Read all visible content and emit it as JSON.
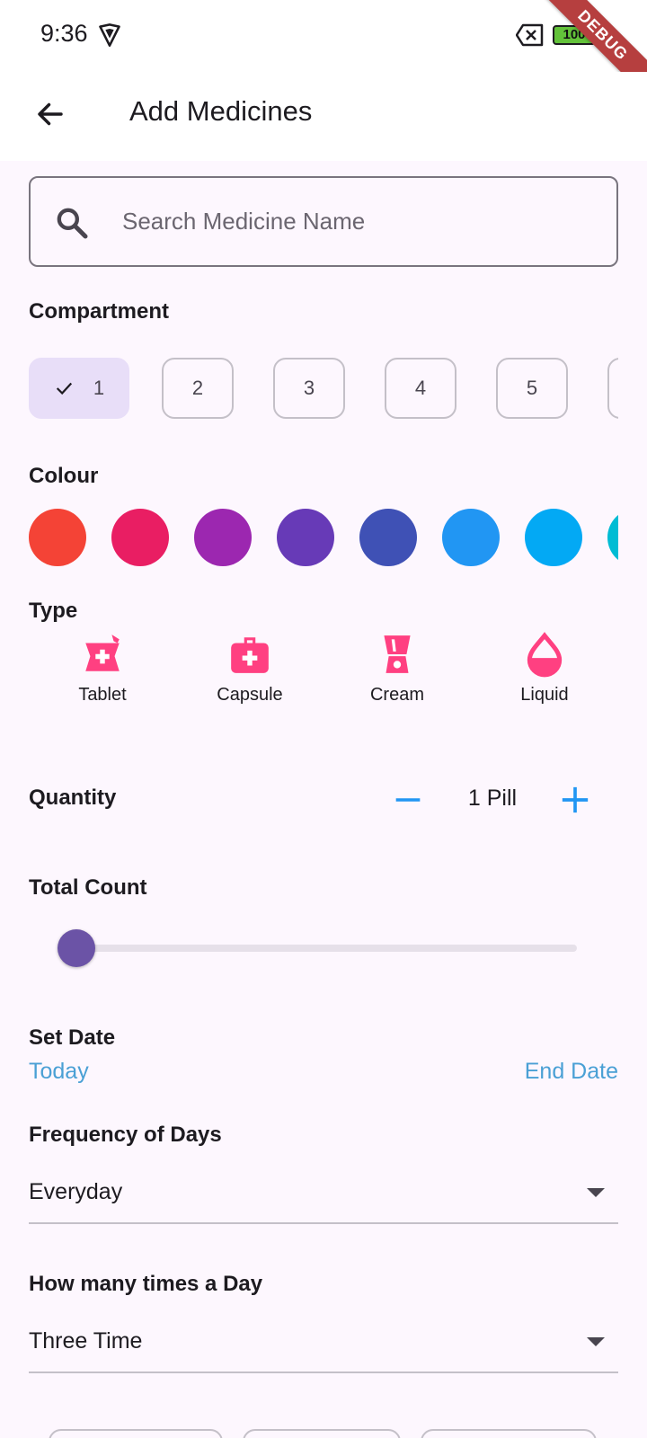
{
  "status_bar": {
    "time": "9:36",
    "battery": "100",
    "debug_label": "DEBUG"
  },
  "app_bar": {
    "title": "Add Medicines"
  },
  "search": {
    "placeholder": "Search Medicine Name",
    "value": ""
  },
  "compartment": {
    "label": "Compartment",
    "selected": "1",
    "options": [
      "1",
      "2",
      "3",
      "4",
      "5"
    ]
  },
  "colour": {
    "label": "Colour",
    "swatches": [
      "#f44336",
      "#e91e63",
      "#9c27b0",
      "#673ab7",
      "#3f51b5",
      "#2196f3",
      "#03a9f4",
      "#00bcd4"
    ],
    "accent": "#ff4081"
  },
  "type": {
    "label": "Type",
    "items": [
      {
        "label": "Tablet",
        "icon": "tablet-icon"
      },
      {
        "label": "Capsule",
        "icon": "capsule-icon"
      },
      {
        "label": "Cream",
        "icon": "cream-icon"
      },
      {
        "label": "Liquid",
        "icon": "liquid-icon"
      }
    ]
  },
  "quantity": {
    "label": "Quantity",
    "value": "1 Pill"
  },
  "total_count": {
    "label": "Total Count",
    "slider_fraction": 0.0
  },
  "set_date": {
    "label": "Set Date",
    "start": "Today",
    "end": "End Date"
  },
  "frequency": {
    "label": "Frequency of Days",
    "value": "Everyday"
  },
  "times_a_day": {
    "label": "How many times a Day",
    "value": "Three Time"
  }
}
